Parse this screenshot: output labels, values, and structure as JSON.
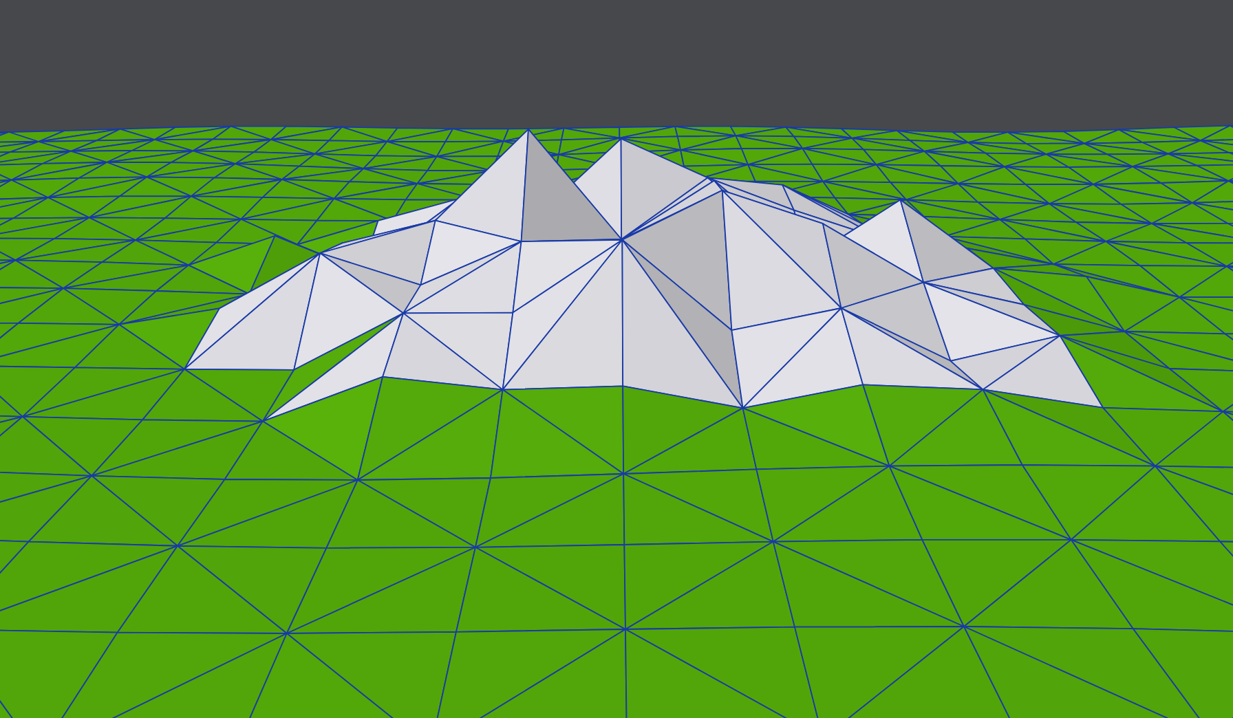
{
  "viewport": {
    "kind": "terrain-render"
  }
}
